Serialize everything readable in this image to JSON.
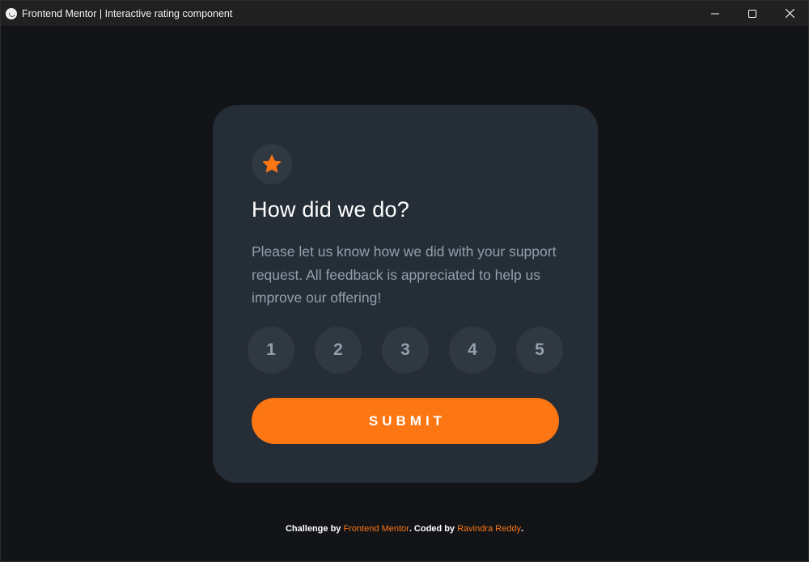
{
  "window": {
    "title": "Frontend Mentor | Interactive rating component",
    "icons": {
      "app": "app-icon",
      "minimize": "minimize-icon",
      "maximize": "maximize-icon",
      "close": "close-icon"
    }
  },
  "card": {
    "icon": "star-icon",
    "heading": "How did we do?",
    "body": "Please let us know how we did with your support request. All feedback is appreciated to help us improve our offering!",
    "ratings": [
      "1",
      "2",
      "3",
      "4",
      "5"
    ],
    "submit_label": "SUBMIT"
  },
  "attribution": {
    "prefix": "Challenge by ",
    "link1": "Frontend Mentor",
    "middle": ". Coded by ",
    "link2": "Ravindra Reddy",
    "suffix": "."
  },
  "colors": {
    "background": "#121417",
    "card": "#252d37",
    "accent": "#fc7614",
    "circle": "#303842",
    "muted_text": "#959eac"
  }
}
